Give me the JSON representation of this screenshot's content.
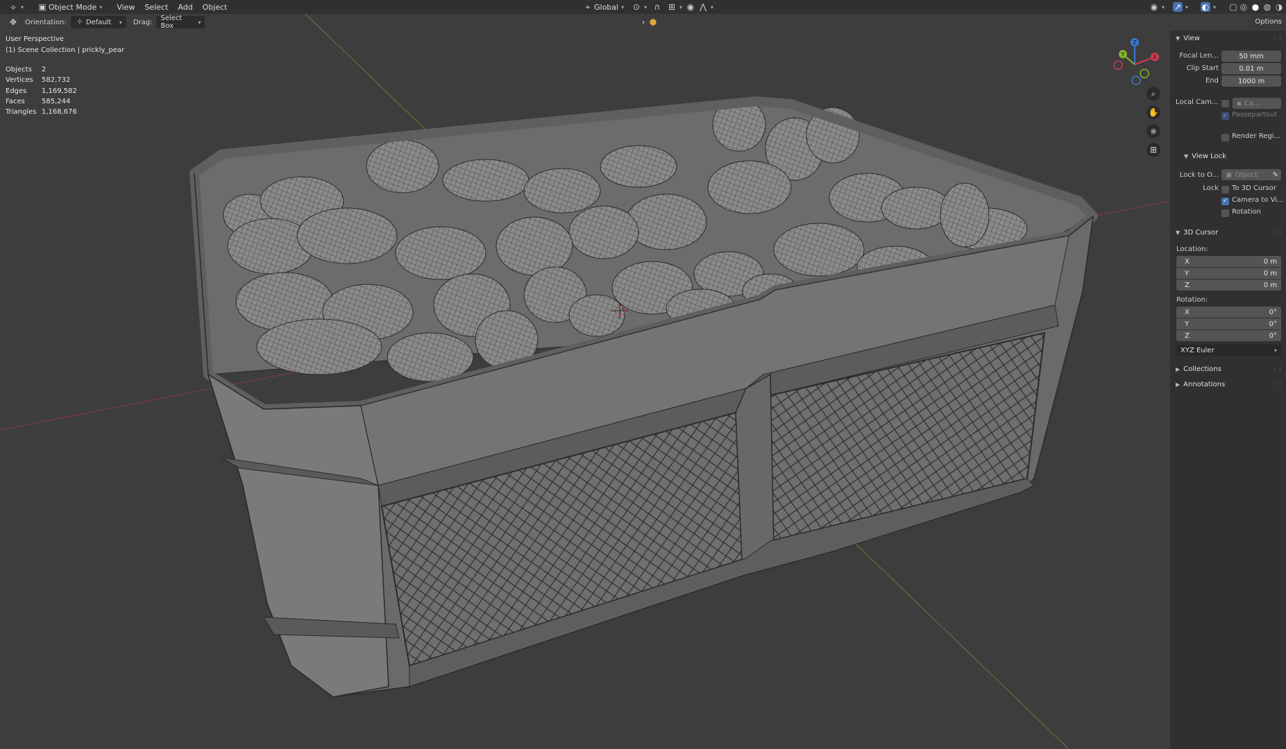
{
  "header": {
    "mode": "Object Mode",
    "menus": [
      "View",
      "Select",
      "Add",
      "Object"
    ],
    "transform_orientation": "Global"
  },
  "tool_settings": {
    "orientation_label": "Orientation:",
    "orientation_value": "Default",
    "drag_label": "Drag:",
    "drag_value": "Select Box"
  },
  "viewport": {
    "perspective": "User Perspective",
    "collection": "(1) Scene Collection | prickly_pear",
    "stats": [
      {
        "label": "Objects",
        "value": "2"
      },
      {
        "label": "Vertices",
        "value": "582,732"
      },
      {
        "label": "Edges",
        "value": "1,169,582"
      },
      {
        "label": "Faces",
        "value": "585,244"
      },
      {
        "label": "Triangles",
        "value": "1,168,676"
      }
    ],
    "gizmo_axes": {
      "x": "X",
      "y": "Y",
      "z": "Z"
    }
  },
  "sidebar": {
    "options_tab": "Options",
    "view": {
      "title": "View",
      "focal_label": "Focal Len...",
      "focal_value": "50 mm",
      "clip_start_label": "Clip Start",
      "clip_start_value": "0.01 m",
      "end_label": "End",
      "end_value": "1000 m",
      "local_cam_label": "Local Cam...",
      "local_cam_value": "Ca...",
      "passepartout_label": "Passepartout",
      "render_region_label": "Render Regi..."
    },
    "view_lock": {
      "title": "View Lock",
      "lock_to_label": "Lock to O...",
      "lock_to_placeholder": "Object",
      "lock_label": "Lock",
      "to_3d_cursor_label": "To 3D Cursor",
      "camera_to_view_label": "Camera to Vi...",
      "rotation_label": "Rotation"
    },
    "cursor": {
      "title": "3D Cursor",
      "location_label": "Location:",
      "location": [
        {
          "axis": "X",
          "value": "0 m"
        },
        {
          "axis": "Y",
          "value": "0 m"
        },
        {
          "axis": "Z",
          "value": "0 m"
        }
      ],
      "rotation_label": "Rotation:",
      "rotation": [
        {
          "axis": "X",
          "value": "0°"
        },
        {
          "axis": "Y",
          "value": "0°"
        },
        {
          "axis": "Z",
          "value": "0°"
        }
      ],
      "rotation_mode": "XYZ Euler"
    },
    "collections_title": "Collections",
    "annotations_title": "Annotations"
  },
  "colors": {
    "header_bg": "#303030",
    "viewport_bg": "#3d3d3d",
    "accent": "#4772b3",
    "axis_x": "#cf3b4e",
    "axis_y": "#86b42c",
    "axis_z": "#3b78cf"
  }
}
